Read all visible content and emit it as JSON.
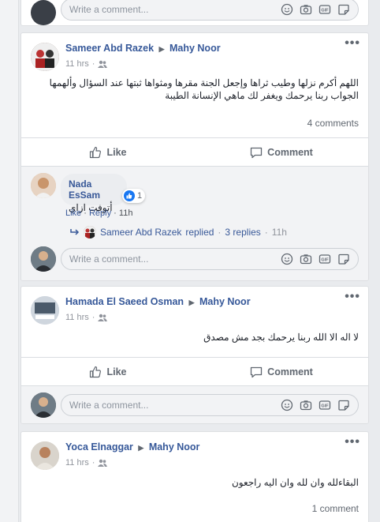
{
  "top_card": {
    "write_placeholder": "Write a comment..."
  },
  "post1": {
    "author": "Sameer Abd Razek",
    "target": "Mahy Noor",
    "time": "11 hrs",
    "text": "اللهم أكرم نزلها وطيب ثراها وإجعل الجنة مقرها ومثواها ثبتها عند السؤال وألهمها الجواب ربنا يرحمك ويغفر لك ماهي الإنسانة الطيبة",
    "comment_count": "4 comments",
    "like_label": "Like",
    "comment_label": "Comment",
    "comment": {
      "name": "Nada EsSam",
      "text": "أتوفت ازاي",
      "reactions": "1",
      "like": "Like",
      "reply": "Reply",
      "time": "11h"
    },
    "replies": {
      "name": "Sameer Abd Razek",
      "action": "replied",
      "count": "3 replies",
      "time": "11h"
    },
    "write_placeholder": "Write a comment..."
  },
  "post2": {
    "author": "Hamada El Saeed Osman",
    "target": "Mahy Noor",
    "time": "11 hrs",
    "text": "لا اله الا الله ربنا يرحمك بجد مش مصدق",
    "like_label": "Like",
    "comment_label": "Comment",
    "write_placeholder": "Write a comment..."
  },
  "post3": {
    "author": "Yoca Elnaggar",
    "target": "Mahy Noor",
    "time": "11 hrs",
    "text": "البقاءلله وان لله وان اليه راجعون",
    "comment_count": "1 comment"
  },
  "colors": {
    "link": "#365899",
    "background": "#e9ebee",
    "like_blue": "#1877f2"
  }
}
